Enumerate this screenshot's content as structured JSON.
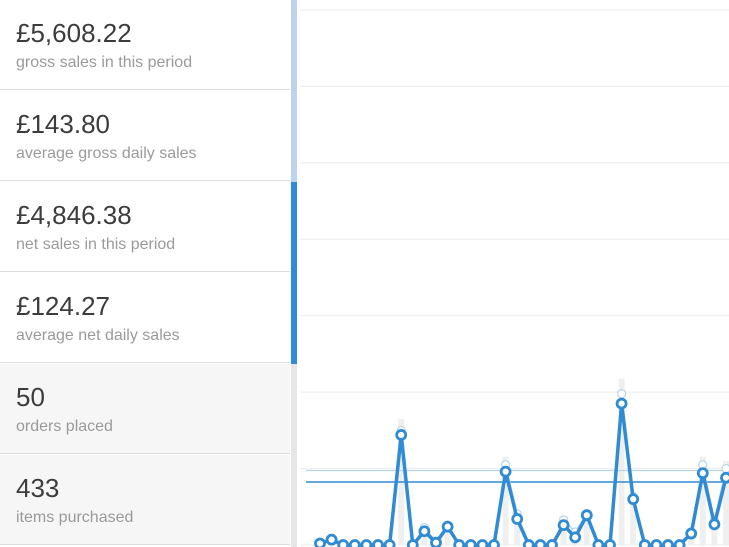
{
  "colors": {
    "net_sales": "#2f8bd3",
    "gross_sales": "#b8d4ec",
    "gross_stripe": "#b9d4ec",
    "net_stripe": "#2f8bd3",
    "grid": "#ececec"
  },
  "legend": {
    "items": [
      {
        "amount": "£5,608.22",
        "label": "gross sales in this period"
      },
      {
        "amount": "£143.80",
        "label": "average gross daily sales"
      },
      {
        "amount": "£4,846.38",
        "label": "net sales in this period"
      },
      {
        "amount": "£124.27",
        "label": "average net daily sales"
      },
      {
        "amount": "50",
        "label": "orders placed"
      },
      {
        "amount": "433",
        "label": "items purchased"
      }
    ]
  },
  "chart_data": {
    "type": "line",
    "grid": true,
    "series": [
      {
        "key": "gross",
        "values": [
          0.2,
          0.8,
          0,
          0,
          0,
          0,
          0,
          15.0,
          0,
          2.3,
          0.5,
          2.6,
          0,
          0,
          0,
          0,
          10.5,
          4.1,
          0,
          0,
          0,
          3.3,
          1.7,
          4.1,
          0,
          0,
          19.8,
          6.3,
          0,
          0,
          0,
          0,
          1.7,
          10.5,
          3.2,
          10.0,
          11.6
        ]
      },
      {
        "key": "net",
        "values": [
          0.2,
          0.7,
          0,
          0,
          0,
          0,
          0,
          14.4,
          0,
          1.8,
          0.3,
          2.4,
          0,
          0,
          0,
          0,
          9.6,
          3.4,
          0,
          0,
          0,
          2.6,
          1.0,
          3.9,
          0,
          0,
          18.5,
          6.0,
          0,
          0,
          0,
          0,
          1.5,
          9.4,
          2.7,
          8.8,
          9.9
        ]
      }
    ],
    "averages": {
      "gross": 1.3,
      "net": 1.1
    },
    "ylim": [
      0,
      70
    ]
  }
}
